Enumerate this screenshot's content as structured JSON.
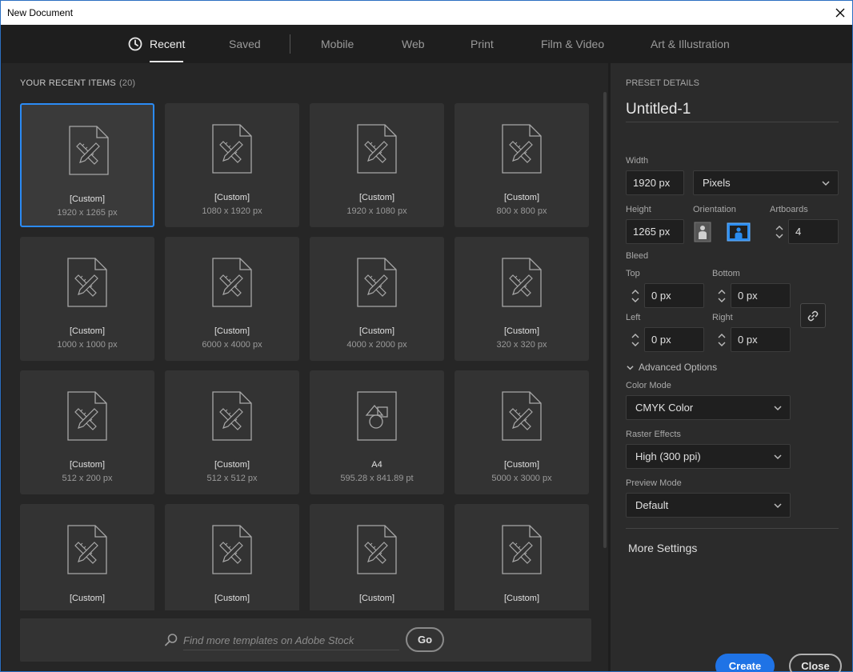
{
  "window": {
    "title": "New Document"
  },
  "tabs": [
    {
      "label": "Recent"
    },
    {
      "label": "Saved"
    },
    {
      "label": "Mobile"
    },
    {
      "label": "Web"
    },
    {
      "label": "Print"
    },
    {
      "label": "Film & Video"
    },
    {
      "label": "Art & Illustration"
    }
  ],
  "recent": {
    "title": "YOUR RECENT ITEMS",
    "count": "(20)",
    "items": [
      {
        "name": "[Custom]",
        "size": "1920 x 1265 px",
        "icon": "custom-document-icon"
      },
      {
        "name": "[Custom]",
        "size": "1080 x 1920 px",
        "icon": "custom-document-icon"
      },
      {
        "name": "[Custom]",
        "size": "1920 x 1080 px",
        "icon": "custom-document-icon"
      },
      {
        "name": "[Custom]",
        "size": "800 x 800 px",
        "icon": "custom-document-icon"
      },
      {
        "name": "[Custom]",
        "size": "1000 x 1000 px",
        "icon": "custom-document-icon"
      },
      {
        "name": "[Custom]",
        "size": "6000 x 4000 px",
        "icon": "custom-document-icon"
      },
      {
        "name": "[Custom]",
        "size": "4000 x 2000 px",
        "icon": "custom-document-icon"
      },
      {
        "name": "[Custom]",
        "size": "320 x 320 px",
        "icon": "custom-document-icon"
      },
      {
        "name": "[Custom]",
        "size": "512 x 200 px",
        "icon": "custom-document-icon"
      },
      {
        "name": "[Custom]",
        "size": "512 x 512 px",
        "icon": "custom-document-icon"
      },
      {
        "name": "A4",
        "size": "595.28 x 841.89 pt",
        "icon": "print-document-icon"
      },
      {
        "name": "[Custom]",
        "size": "5000 x 3000 px",
        "icon": "custom-document-icon"
      },
      {
        "name": "[Custom]",
        "size": "",
        "icon": "custom-document-icon"
      },
      {
        "name": "[Custom]",
        "size": "",
        "icon": "custom-document-icon"
      },
      {
        "name": "[Custom]",
        "size": "",
        "icon": "custom-document-icon"
      },
      {
        "name": "[Custom]",
        "size": "",
        "icon": "custom-document-icon"
      }
    ]
  },
  "search": {
    "placeholder": "Find more templates on Adobe Stock",
    "value": "",
    "go_label": "Go"
  },
  "preset": {
    "header": "PRESET DETAILS",
    "name": "Untitled-1",
    "width_label": "Width",
    "width_value": "1920 px",
    "unit": "Pixels",
    "height_label": "Height",
    "height_value": "1265 px",
    "orientation_label": "Orientation",
    "orientation_selected": "landscape",
    "artboards_label": "Artboards",
    "artboards_value": "4",
    "bleed_label": "Bleed",
    "bleed": {
      "top_label": "Top",
      "top_value": "0 px",
      "bottom_label": "Bottom",
      "bottom_value": "0 px",
      "left_label": "Left",
      "left_value": "0 px",
      "right_label": "Right",
      "right_value": "0 px"
    },
    "advanced_label": "Advanced Options",
    "color_mode_label": "Color Mode",
    "color_mode_value": "CMYK Color",
    "raster_label": "Raster Effects",
    "raster_value": "High (300 ppi)",
    "preview_label": "Preview Mode",
    "preview_value": "Default",
    "more_settings": "More Settings",
    "create_label": "Create",
    "close_label": "Close"
  },
  "colors": {
    "accent": "#2b8bf5",
    "create": "#1f73e6",
    "panel": "#2b2b2b",
    "background": "#262626"
  }
}
